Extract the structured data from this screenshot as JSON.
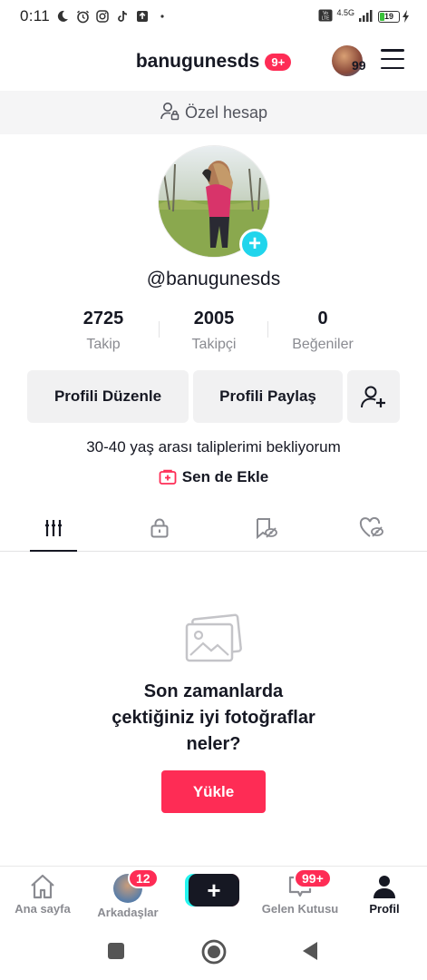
{
  "status_bar": {
    "time": "0:11",
    "network": "4.5G",
    "battery": "19"
  },
  "header": {
    "username": "banugunesds",
    "badge": "9+",
    "avatar_count": "99"
  },
  "private_notice": "Özel hesap",
  "profile": {
    "handle": "@banugunesds",
    "stats": [
      {
        "value": "2725",
        "label": "Takip"
      },
      {
        "value": "2005",
        "label": "Takipçi"
      },
      {
        "value": "0",
        "label": "Beğeniler"
      }
    ],
    "buttons": {
      "edit": "Profili Düzenle",
      "share": "Profili Paylaş"
    },
    "bio": "30-40 yaş arası taliplerimi bekliyorum",
    "add_link": "Sen de Ekle"
  },
  "empty_state": {
    "line1": "Son zamanlarda",
    "line2": "çektiğiniz iyi fotoğraflar",
    "line3": "neler?",
    "button": "Yükle"
  },
  "bottom_nav": {
    "home": "Ana sayfa",
    "friends": "Arkadaşlar",
    "friends_badge": "12",
    "inbox": "Gelen Kutusu",
    "inbox_badge": "99+",
    "profile": "Profil",
    "create": "+"
  },
  "colors": {
    "accent": "#fe2c55",
    "cyan": "#20d5ec",
    "text": "#161823",
    "muted": "#8a8b91"
  }
}
